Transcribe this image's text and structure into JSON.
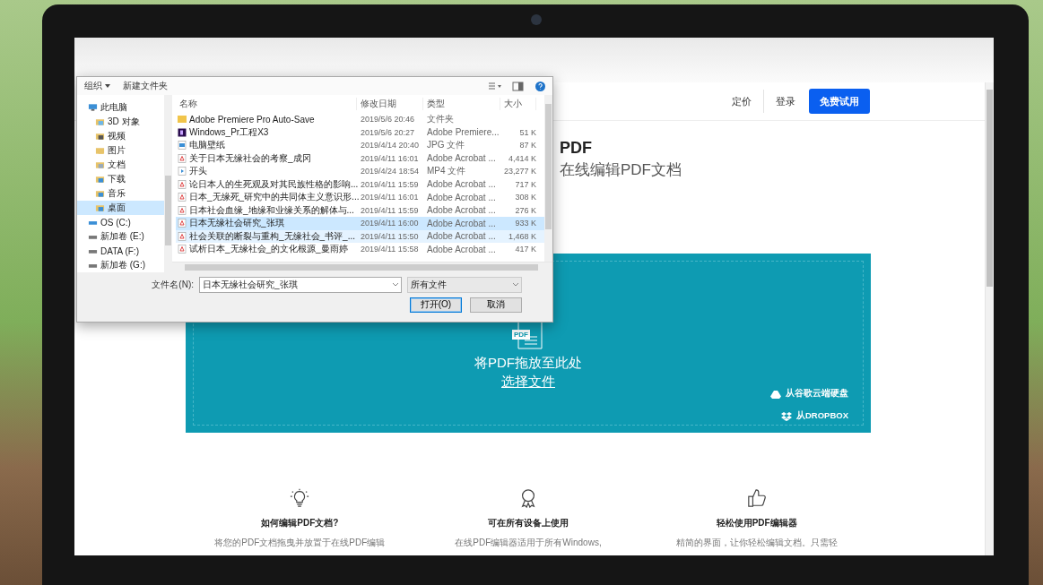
{
  "dialog": {
    "toolbar": {
      "organize": "组织",
      "new_folder": "新建文件夹"
    },
    "nav": [
      {
        "label": "此电脑",
        "kind": "pc",
        "selected": false
      },
      {
        "label": "3D 对象",
        "kind": "folder3d",
        "selected": false
      },
      {
        "label": "视频",
        "kind": "video",
        "selected": false
      },
      {
        "label": "图片",
        "kind": "pictures",
        "selected": false
      },
      {
        "label": "文档",
        "kind": "docs",
        "selected": false
      },
      {
        "label": "下载",
        "kind": "downloads",
        "selected": false
      },
      {
        "label": "音乐",
        "kind": "music",
        "selected": false
      },
      {
        "label": "桌面",
        "kind": "desktop",
        "selected": true
      },
      {
        "label": "OS (C:)",
        "kind": "system",
        "selected": false
      },
      {
        "label": "新加卷 (E:)",
        "kind": "drive",
        "selected": false
      },
      {
        "label": "DATA (F:)",
        "kind": "drive",
        "selected": false
      },
      {
        "label": "新加卷 (G:)",
        "kind": "drive",
        "selected": false
      }
    ],
    "columns": [
      "名称",
      "修改日期",
      "类型",
      "大小"
    ],
    "files": [
      {
        "name": "Adobe Premiere Pro Auto-Save",
        "date": "2019/5/6 20:46",
        "type": "文件夹",
        "kind": "folder",
        "selected": false,
        "hover": false
      },
      {
        "name": "Windows_Pr工程X3",
        "date": "2019/5/6 20:27",
        "type": "Adobe Premiere...",
        "size": "51 K",
        "kind": "premiere",
        "selected": false,
        "hover": false
      },
      {
        "name": "电脑壁纸",
        "date": "2019/4/14 20:40",
        "type": "JPG 文件",
        "size": "87 K",
        "kind": "image",
        "selected": false,
        "hover": false
      },
      {
        "name": "关于日本无缘社会的考察_成冈",
        "date": "2019/4/11 16:01",
        "type": "Adobe Acrobat ...",
        "size": "4,414 K",
        "kind": "pdf",
        "selected": false,
        "hover": false
      },
      {
        "name": "开头",
        "date": "2019/4/24 18:54",
        "type": "MP4 文件",
        "size": "23,277 K",
        "kind": "video",
        "selected": false,
        "hover": false
      },
      {
        "name": "论日本人的生死观及对其民族性格的影响...",
        "date": "2019/4/11 15:59",
        "type": "Adobe Acrobat ...",
        "size": "717 K",
        "kind": "pdf",
        "selected": false,
        "hover": false
      },
      {
        "name": "日本_无缘死_研究中的共同体主义意识形...",
        "date": "2019/4/11 16:01",
        "type": "Adobe Acrobat ...",
        "size": "308 K",
        "kind": "pdf",
        "selected": false,
        "hover": false
      },
      {
        "name": "日本社会血缘_地缘和业缘关系的解体与...",
        "date": "2019/4/11 15:59",
        "type": "Adobe Acrobat ...",
        "size": "276 K",
        "kind": "pdf",
        "selected": false,
        "hover": false
      },
      {
        "name": "日本无缘社会研究_张琪",
        "date": "2019/4/11 16:00",
        "type": "Adobe Acrobat ...",
        "size": "933 K",
        "kind": "pdf",
        "selected": true,
        "hover": false
      },
      {
        "name": "社会关联的断裂与重构_无缘社会_书评_...",
        "date": "2019/4/11 15:50",
        "type": "Adobe Acrobat ...",
        "size": "1,468 K",
        "kind": "pdf",
        "selected": false,
        "hover": true
      },
      {
        "name": "试析日本_无缘社会_的文化根源_曼雨婷",
        "date": "2019/4/11 15:58",
        "type": "Adobe Acrobat ...",
        "size": "417 K",
        "kind": "pdf",
        "selected": false,
        "hover": false
      }
    ],
    "filename_label": "文件名(N):",
    "filename": "日本无缘社会研究_张琪",
    "filter": "所有文件",
    "buttons": [
      {
        "label": "打开(O)",
        "default": true
      },
      {
        "label": "取消",
        "default": false
      }
    ]
  },
  "page": {
    "nav": [
      "定价",
      "登录"
    ],
    "cta": "免费试用",
    "heading": "PDF",
    "subheading": "在线编辑PDF文档",
    "dropzone": {
      "file_icon_label": "PDF",
      "prompt": "将PDF拖放至此处",
      "link": "选择文件",
      "sources": [
        {
          "label": "从谷歌云端硬盘",
          "kind": "drive"
        },
        {
          "label": "从DROPBOX",
          "kind": "dropbox"
        }
      ]
    },
    "features": [
      {
        "kind": "bulb",
        "title": "如何编辑PDF文档?",
        "text": "将您的PDF文档拖曳并放置于在线PDF编辑"
      },
      {
        "kind": "award",
        "title": "可在所有设备上使用",
        "text": "在线PDF编辑器适用于所有Windows,"
      },
      {
        "kind": "thumb",
        "title": "轻松使用PDF编辑器",
        "text": "精简的界面，让你轻松编辑文档。只需轻"
      }
    ]
  }
}
